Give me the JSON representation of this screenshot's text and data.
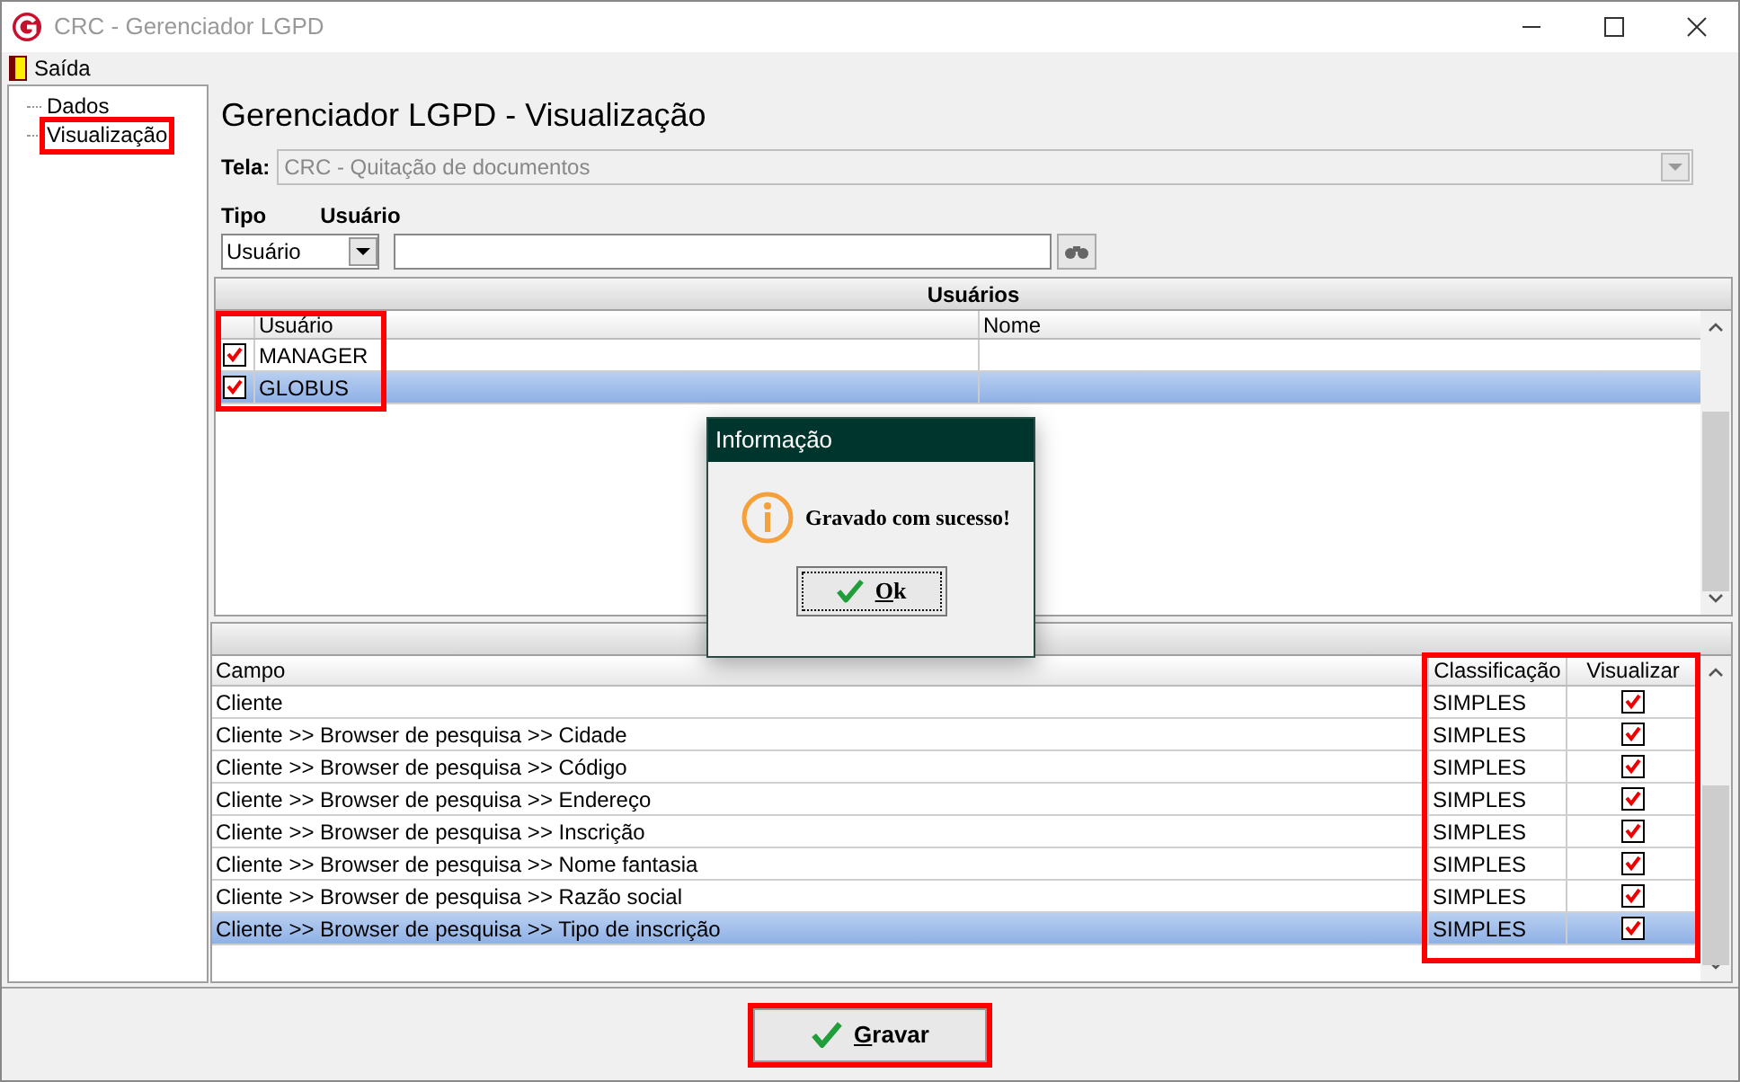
{
  "window": {
    "title": "CRC - Gerenciador LGPD"
  },
  "menu": [
    {
      "label": "Saída"
    }
  ],
  "tree": [
    {
      "label": "Dados",
      "highlighted": false
    },
    {
      "label": "Visualização",
      "highlighted": true
    }
  ],
  "heading": "Gerenciador LGPD - Visualização",
  "tela": {
    "label": "Tela:",
    "value": "CRC - Quitação de documentos",
    "disabled": true
  },
  "filter": {
    "tipo_label": "Tipo",
    "tipo_value": "Usuário",
    "usuario_label": "Usuário"
  },
  "users": {
    "title": "Usuários",
    "highlighted": true,
    "columns": [
      "Usuário",
      "Nome"
    ],
    "rows": [
      {
        "usuario": "MANAGER",
        "checked": true,
        "selected": false
      },
      {
        "usuario": "GLOBUS",
        "checked": true,
        "selected": true
      }
    ]
  },
  "fields": {
    "highlighted": true,
    "columns": [
      {
        "label": "Campo"
      },
      {
        "label": "Classificação"
      },
      {
        "label": "Visualizar"
      }
    ],
    "rows": [
      {
        "campo": "Cliente",
        "classificacao": "SIMPLES",
        "checked": true,
        "selected": false
      },
      {
        "campo": "Cliente >> Browser de pesquisa >> Cidade",
        "classificacao": "SIMPLES",
        "checked": true,
        "selected": false
      },
      {
        "campo": "Cliente >> Browser de pesquisa >> Código",
        "classificacao": "SIMPLES",
        "checked": true,
        "selected": false
      },
      {
        "campo": "Cliente >> Browser de pesquisa >> Endereço",
        "classificacao": "SIMPLES",
        "checked": true,
        "selected": false
      },
      {
        "campo": "Cliente >> Browser de pesquisa >> Inscrição",
        "classificacao": "SIMPLES",
        "checked": true,
        "selected": false
      },
      {
        "campo": "Cliente >> Browser de pesquisa >> Nome fantasia",
        "classificacao": "SIMPLES",
        "checked": true,
        "selected": false
      },
      {
        "campo": "Cliente >> Browser de pesquisa >> Razão social",
        "classificacao": "SIMPLES",
        "checked": true,
        "selected": false
      },
      {
        "campo": "Cliente >> Browser de pesquisa >> Tipo de inscrição",
        "classificacao": "SIMPLES",
        "checked": true,
        "selected": true
      }
    ]
  },
  "save_button": {
    "accel": "G",
    "rest": "ravar",
    "highlighted": true
  },
  "dialog": {
    "title": "Informação",
    "message": "Gravado com sucesso!",
    "button_accel": "O",
    "button_rest": "k"
  }
}
